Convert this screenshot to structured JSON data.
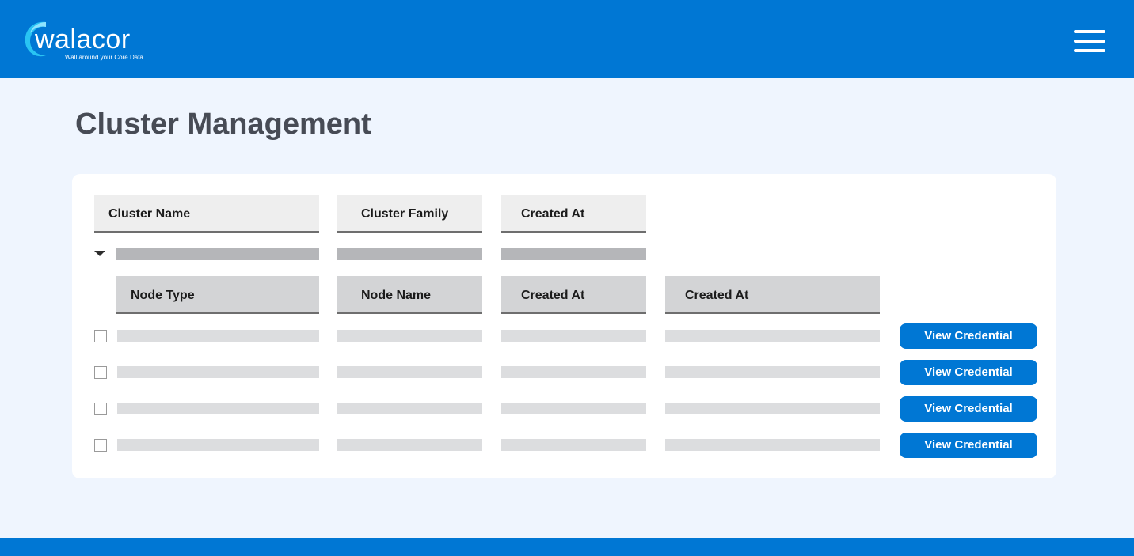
{
  "brand": {
    "name": "walacor",
    "tagline": "Wall around your Core Data",
    "primary_color": "#0077D4",
    "background_color": "#EFF5FE"
  },
  "header": {
    "menu_icon": "hamburger-menu-icon"
  },
  "page": {
    "title": "Cluster Management"
  },
  "cluster_table": {
    "columns": [
      "Cluster Name",
      "Cluster Family",
      "Created At"
    ],
    "expanded": true,
    "node_table": {
      "columns": [
        "Node Type",
        "Node Name",
        "Created At",
        "Created At"
      ],
      "rows": [
        {
          "action_label": "View Credential"
        },
        {
          "action_label": "View Credential"
        },
        {
          "action_label": "View Credential"
        },
        {
          "action_label": "View Credential"
        }
      ]
    }
  }
}
